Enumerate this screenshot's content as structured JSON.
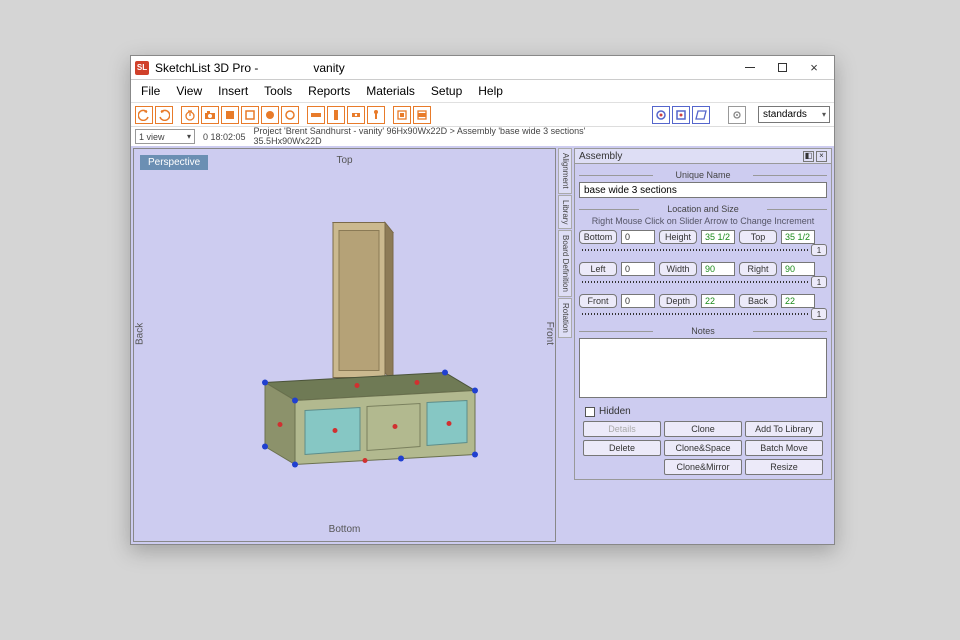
{
  "title": {
    "app": "SketchList 3D Pro -",
    "doc": "vanity"
  },
  "menu": [
    "File",
    "View",
    "Insert",
    "Tools",
    "Reports",
    "Materials",
    "Setup",
    "Help"
  ],
  "toolbar": {
    "standards_label": "standards"
  },
  "secondbar": {
    "view": "1 view",
    "timer": "0 18:02:05",
    "path1": "Project 'Brent Sandhurst - vanity'  96Hx90Wx22D > Assembly 'base wide 3 sections'",
    "path2": "35.5Hx90Wx22D"
  },
  "viewport": {
    "badge": "Perspective",
    "top": "Top",
    "bottom": "Bottom",
    "left": "Back",
    "right": "Front"
  },
  "vtabs": [
    "Alignment",
    "Library",
    "Board Definition",
    "Rotation"
  ],
  "panel": {
    "header": "Assembly",
    "unique_name_label": "Unique Name",
    "unique_name": "base wide 3 sections",
    "loc_label": "Location and Size",
    "hint": "Right Mouse Click on Slider Arrow to Change Increment",
    "rows": [
      {
        "a": "Bottom",
        "av": "0",
        "b": "Height",
        "bv": "35 1/2",
        "c": "Top",
        "cv": "35 1/2",
        "inc": "1"
      },
      {
        "a": "Left",
        "av": "0",
        "b": "Width",
        "bv": "90",
        "c": "Right",
        "cv": "90",
        "inc": "1"
      },
      {
        "a": "Front",
        "av": "0",
        "b": "Depth",
        "bv": "22",
        "c": "Back",
        "cv": "22",
        "inc": "1"
      }
    ],
    "notes_label": "Notes",
    "hidden_label": "Hidden",
    "buttons": {
      "details": "Details",
      "clone": "Clone",
      "addlib": "Add To Library",
      "delete": "Delete",
      "clonespace": "Clone&Space",
      "batch": "Batch Move",
      "clonemirror": "Clone&Mirror",
      "resize": "Resize"
    }
  }
}
